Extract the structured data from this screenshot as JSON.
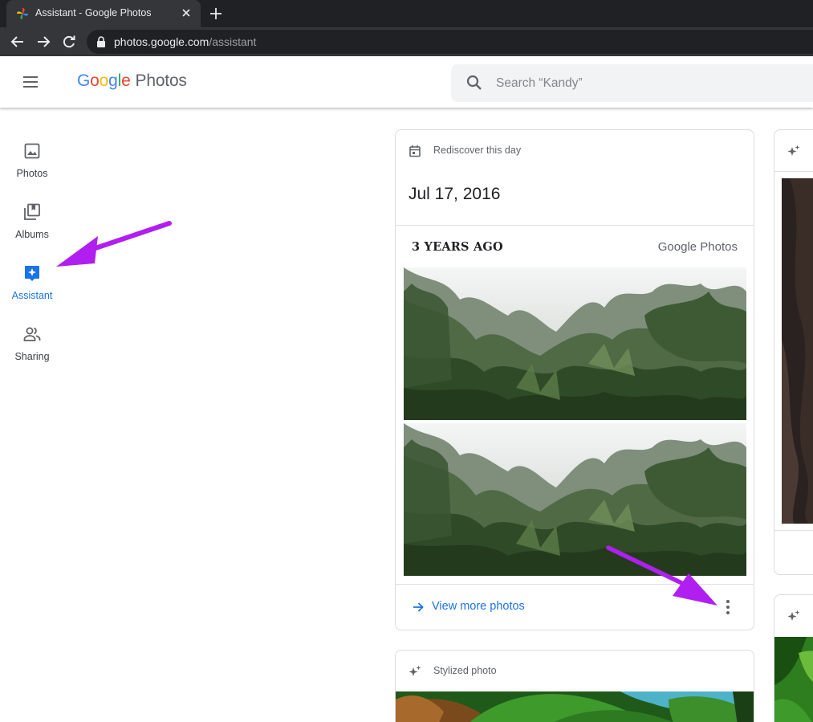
{
  "browser": {
    "tab_title": "Assistant - Google Photos",
    "url_host": "photos.google.com",
    "url_path": "/assistant"
  },
  "header": {
    "logo_letters": [
      "G",
      "o",
      "o",
      "g",
      "l",
      "e"
    ],
    "logo_product": "Photos",
    "search_placeholder": "Search “Kandy”"
  },
  "sidebar": {
    "items": [
      {
        "label": "Photos",
        "icon": "photo-icon",
        "active": false
      },
      {
        "label": "Albums",
        "icon": "albums-icon",
        "active": false
      },
      {
        "label": "Assistant",
        "icon": "assistant-icon",
        "active": true
      },
      {
        "label": "Sharing",
        "icon": "sharing-icon",
        "active": false
      }
    ]
  },
  "cards": {
    "rediscover": {
      "kicker": "Rediscover this day",
      "date": "Jul 17, 2016",
      "years_ago": "3 YEARS AGO",
      "brand": "Google Photos",
      "action_label": "View more photos"
    },
    "stylized": {
      "kicker": "Stylized photo"
    }
  },
  "colors": {
    "accent": "#1a73e8",
    "annotation_arrow": "#b01ff0"
  }
}
